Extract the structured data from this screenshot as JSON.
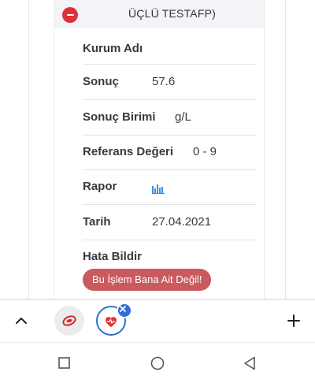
{
  "card": {
    "header_title": "ÜÇLÜ TESTAFP)",
    "rows": [
      {
        "label": "Kurum Adı",
        "value": ""
      },
      {
        "label": "Sonuç",
        "value": "57.6"
      },
      {
        "label": "Sonuç Birimi",
        "value": "g/L"
      },
      {
        "label": "Referans Değeri",
        "value": "0 - 9"
      },
      {
        "label": "Rapor",
        "value": ""
      },
      {
        "label": "Tarih",
        "value": "27.04.2021"
      },
      {
        "label": "Hata Bildir",
        "value": ""
      }
    ],
    "report_button": "Bu İşlem Bana Ait Değil!"
  },
  "colors": {
    "collapse": "#e0303a",
    "report_button": "#c95a5e",
    "active_tab": "#2f6fd6",
    "chart_icon": "#3b8ee6"
  },
  "icons": {
    "collapse": "minus-circle-icon",
    "report": "bar-chart-icon",
    "tabs_up": "chevron-up-icon",
    "tab1": "edevlet-logo-icon",
    "tab2": "health-heart-icon",
    "tab_close": "close-icon",
    "new_tab": "plus-icon",
    "recents": "square-icon",
    "home": "circle-icon",
    "back": "triangle-back-icon"
  }
}
